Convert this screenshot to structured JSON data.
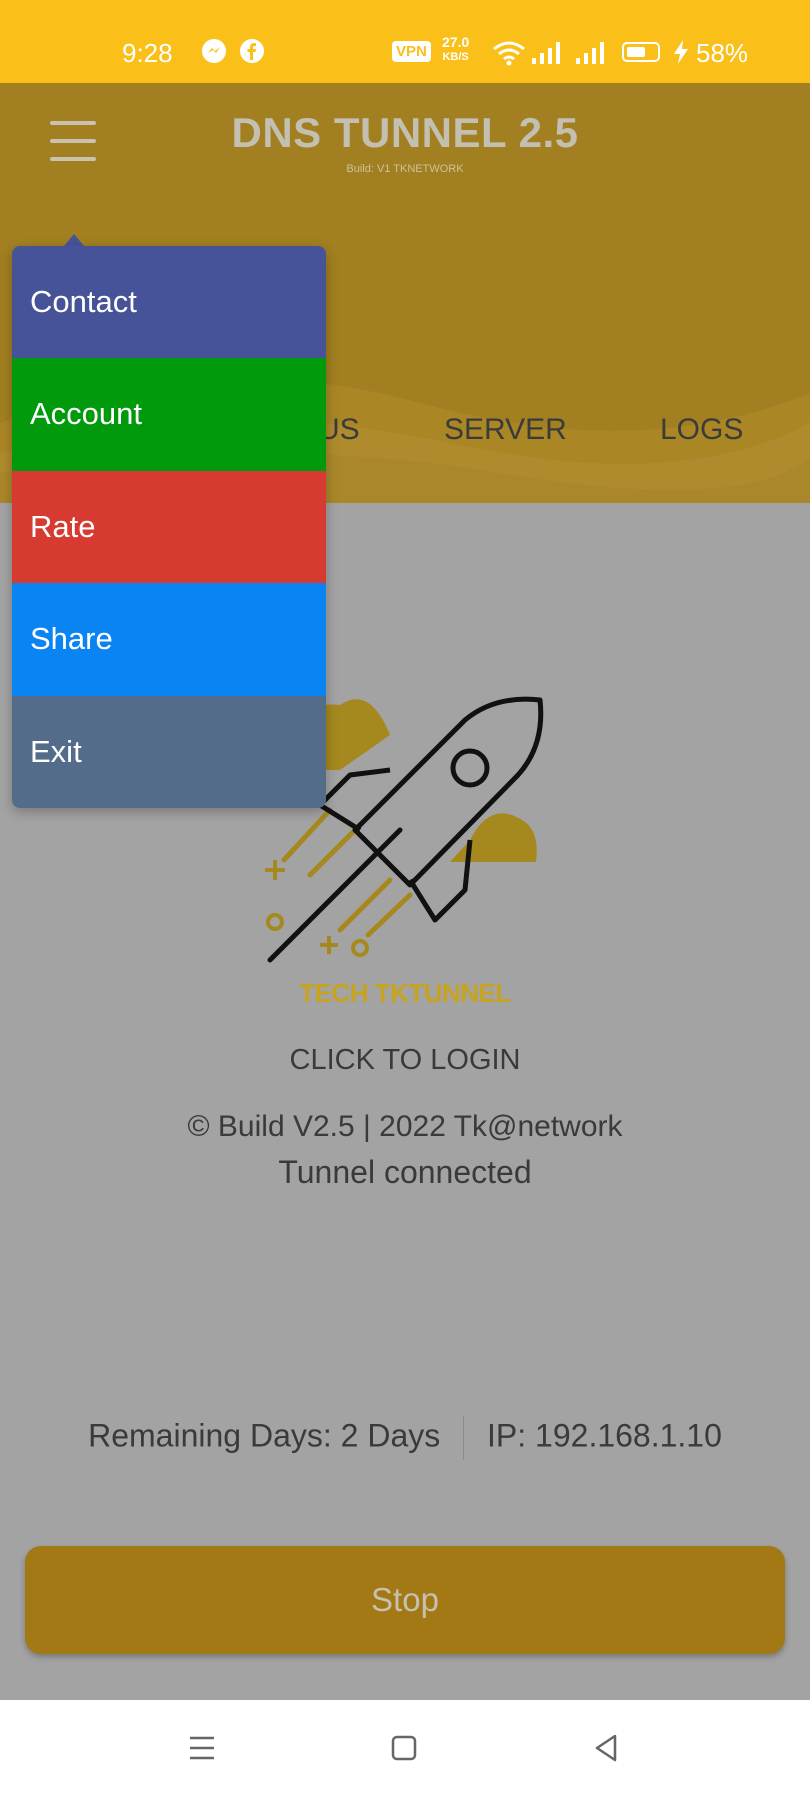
{
  "status_bar": {
    "time": "9:28",
    "vpn_label": "VPN",
    "speed_value": "27.0",
    "speed_unit": "KB/S",
    "battery_percent": "58%",
    "battery_level": 0.58,
    "icons": [
      "messenger-icon",
      "facebook-icon",
      "wifi-icon",
      "signal-icon",
      "signal-icon",
      "battery-icon",
      "charging-icon"
    ]
  },
  "header": {
    "title": "DNS TUNNEL 2.5",
    "subtitle": "Build: V1 TKNETWORK",
    "accent_color": "#a27f20"
  },
  "tabs": {
    "status_partial": "US",
    "server": "SERVER",
    "logs": "LOGS"
  },
  "main": {
    "brand": "TECH TKTUNNEL",
    "click_to_login": "CLICK TO LOGIN",
    "build_line": "© Build V2.5 | 2022 Tk@network",
    "connection_status": "Tunnel connected",
    "remaining_days_label": "Remaining Days:",
    "remaining_days_value": "2 Days",
    "ip_label": "IP:",
    "ip_value": "192.168.1.10",
    "stop_button": "Stop"
  },
  "menu": {
    "items": [
      {
        "label": "Contact",
        "color": "#465398"
      },
      {
        "label": "Account",
        "color": "#009a0c"
      },
      {
        "label": "Rate",
        "color": "#d63a31"
      },
      {
        "label": "Share",
        "color": "#0b84f3"
      },
      {
        "label": "Exit",
        "color": "#536c89"
      }
    ]
  },
  "nav_bar": {
    "icons": [
      "recents-icon",
      "home-icon",
      "back-icon"
    ]
  }
}
